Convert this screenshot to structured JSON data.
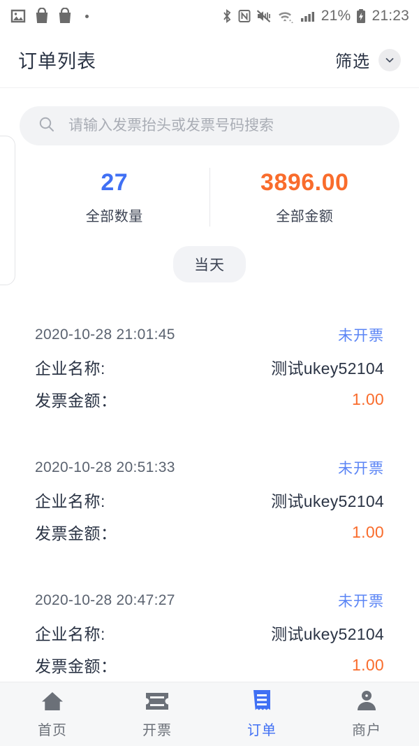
{
  "statusbar": {
    "left_icons": [
      "image-icon",
      "shopping-bag-icon",
      "shopping-bag-icon",
      "dot-indicator"
    ],
    "right_icons": [
      "bluetooth-icon",
      "nfc-icon",
      "mute-vibrate-icon",
      "wifi-icon",
      "cellular-signal-icon",
      "battery-charging-icon"
    ],
    "battery_percent": "21%",
    "clock": "21:23"
  },
  "header": {
    "title": "订单列表",
    "filter_label": "筛选",
    "filter_icon": "chevron-down-icon"
  },
  "search": {
    "placeholder": "请输入发票抬头或发票号码搜索",
    "value": "",
    "icon": "search-icon"
  },
  "stats": [
    {
      "value": "27",
      "label": "全部数量",
      "color": "#4070f4"
    },
    {
      "value": "3896.00",
      "label": "全部金额",
      "color": "#f96c2c"
    }
  ],
  "group_pill": "当天",
  "list": {
    "labels": {
      "company": "企业名称:",
      "amount": "发票金额："
    },
    "items": [
      {
        "time": "2020-10-28 21:01:45",
        "status": "未开票",
        "company": "测试ukey52104",
        "amount": "1.00"
      },
      {
        "time": "2020-10-28 20:51:33",
        "status": "未开票",
        "company": "测试ukey52104",
        "amount": "1.00"
      },
      {
        "time": "2020-10-28 20:47:27",
        "status": "未开票",
        "company": "测试ukey52104",
        "amount": "1.00"
      }
    ]
  },
  "tabbar": {
    "items": [
      {
        "label": "首页",
        "icon": "home-icon",
        "active": false
      },
      {
        "label": "开票",
        "icon": "ticket-icon",
        "active": false
      },
      {
        "label": "订单",
        "icon": "receipt-icon",
        "active": true
      },
      {
        "label": "商户",
        "icon": "person-icon",
        "active": false
      }
    ]
  },
  "colors": {
    "accent_blue": "#4070f4",
    "accent_orange": "#f96c2c",
    "status_blue": "#5b85f5",
    "text_dark": "#2b3445",
    "text_muted": "#5b6370",
    "tabbar_bg": "#f6f7f8"
  }
}
